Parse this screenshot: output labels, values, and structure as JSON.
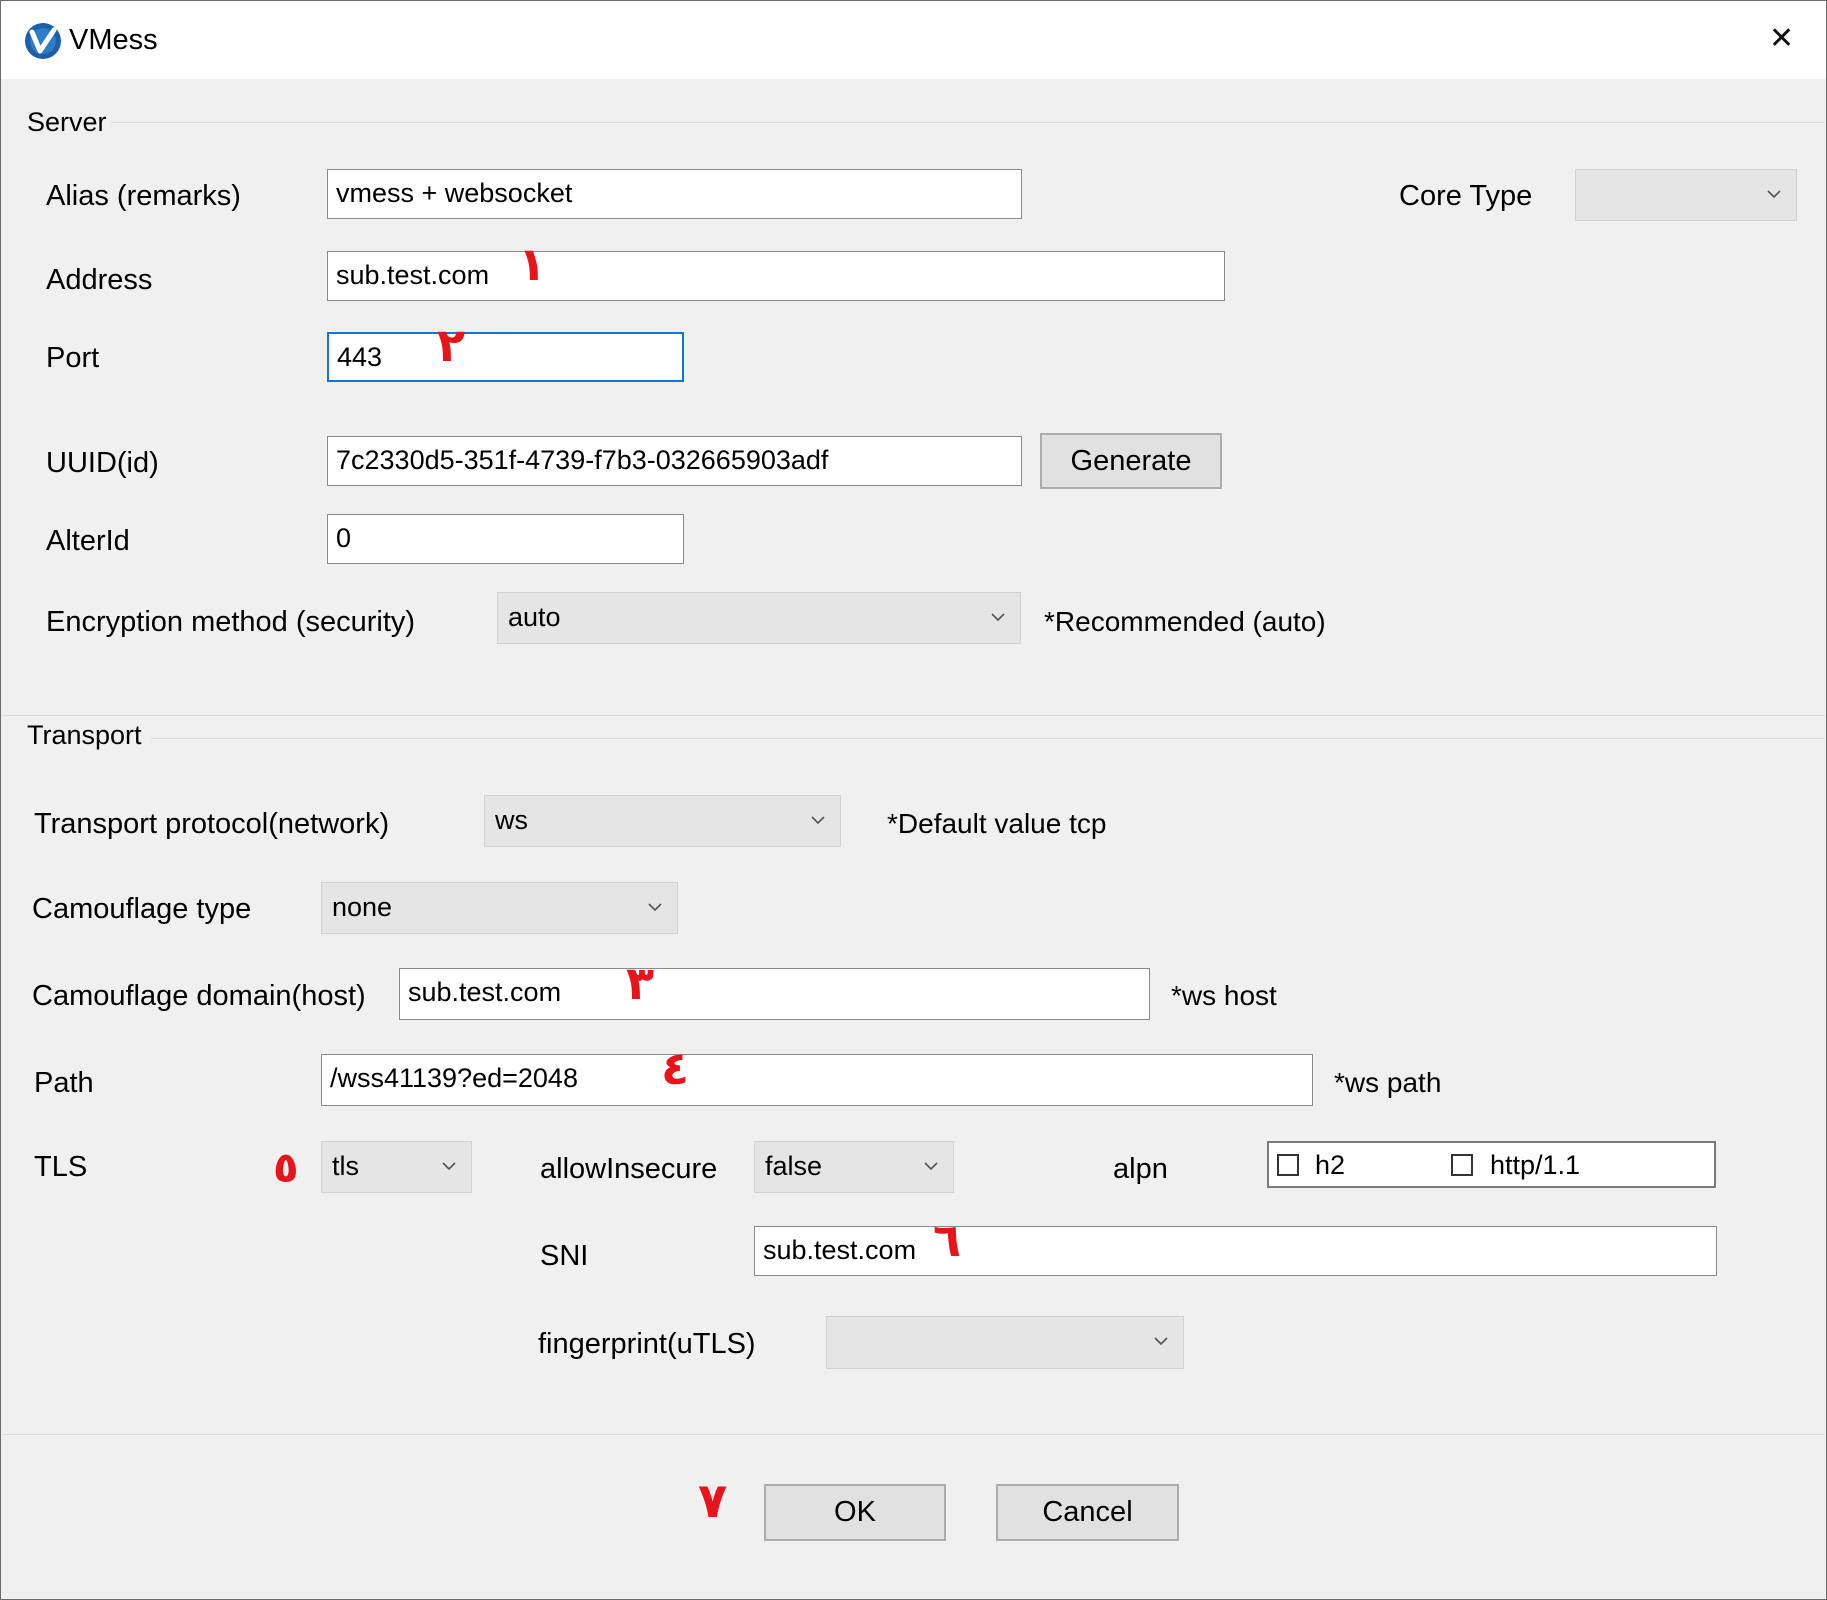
{
  "window": {
    "title": "VMess",
    "close_glyph": "✕",
    "app_icon": "v-logo-icon"
  },
  "server": {
    "group_label": "Server",
    "alias": {
      "label": "Alias (remarks)",
      "value": "vmess + websocket"
    },
    "core_type": {
      "label": "Core Type",
      "value": ""
    },
    "address": {
      "label": "Address",
      "value": "sub.test.com"
    },
    "port": {
      "label": "Port",
      "value": "443"
    },
    "uuid": {
      "label": "UUID(id)",
      "value": "7c2330d5-351f-4739-f7b3-032665903adf",
      "generate_label": "Generate"
    },
    "alterid": {
      "label": "AlterId",
      "value": "0"
    },
    "encryption": {
      "label": "Encryption method (security)",
      "value": "auto",
      "note": "*Recommended (auto)"
    }
  },
  "transport": {
    "group_label": "Transport",
    "protocol": {
      "label": "Transport protocol(network)",
      "value": "ws",
      "note": "*Default value tcp"
    },
    "camouflage_type": {
      "label": "Camouflage type",
      "value": "none"
    },
    "camouflage_domain": {
      "label": "Camouflage domain(host)",
      "value": "sub.test.com",
      "note": "*ws host"
    },
    "path": {
      "label": "Path",
      "value": "/wss41139?ed=2048",
      "note": "*ws path"
    },
    "tls": {
      "label": "TLS",
      "value": "tls"
    },
    "allow_insecure": {
      "label": "allowInsecure",
      "value": "false"
    },
    "alpn": {
      "label": "alpn",
      "options": [
        {
          "label": "h2",
          "checked": false
        },
        {
          "label": "http/1.1",
          "checked": false
        }
      ]
    },
    "sni": {
      "label": "SNI",
      "value": "sub.test.com"
    },
    "fingerprint": {
      "label": "fingerprint(uTLS)",
      "value": ""
    }
  },
  "buttons": {
    "ok": "OK",
    "cancel": "Cancel"
  },
  "annotations": {
    "m1": "١",
    "m2": "٢",
    "m3": "٣",
    "m4": "٤",
    "m5": "٥",
    "m6": "٦",
    "m7": "٧",
    "color": "#e8141c"
  },
  "colors": {
    "focus_border": "#0a78d7",
    "window_bg": "#f0f0f0",
    "combo_bg": "#e5e5e5",
    "button_bg": "#e1e1e1"
  }
}
